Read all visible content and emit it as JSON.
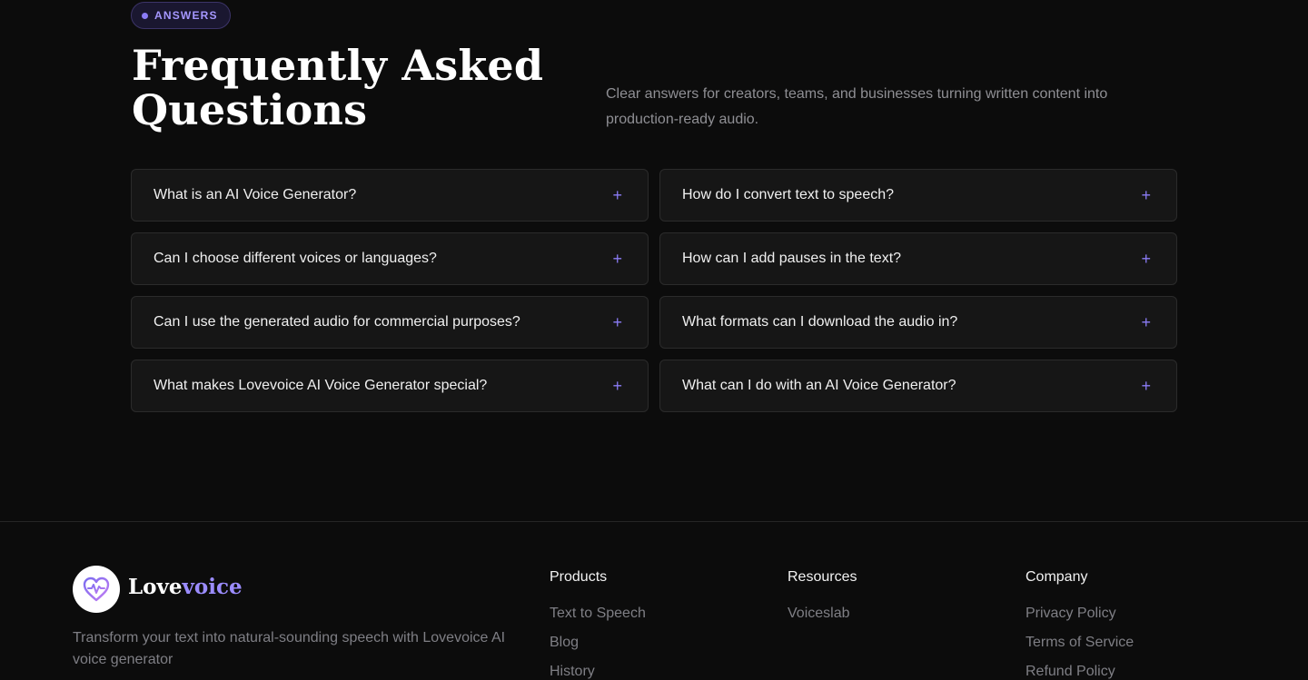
{
  "badge": {
    "label": "ANSWERS"
  },
  "faq": {
    "title_line1": "Frequently Asked",
    "title_line2": "Questions",
    "subtitle": "Clear answers for creators, teams, and businesses turning written content into production-ready audio.",
    "expand_icon": "+",
    "questions": [
      "What is an AI Voice Generator?",
      "How do I convert text to speech?",
      "Can I choose different voices or languages?",
      "How can I add pauses in the text?",
      "Can I use the generated audio for commercial purposes?",
      "What formats can I download the audio in?",
      "What makes Lovevoice AI Voice Generator special?",
      "What can I do with an AI Voice Generator?"
    ]
  },
  "footer": {
    "brand_part1": "Love",
    "brand_part2": "voice",
    "tagline": "Transform your text into natural-sounding speech with Lovevoice AI voice generator",
    "columns": {
      "products": {
        "heading": "Products",
        "links": [
          "Text to Speech",
          "Blog",
          "History"
        ]
      },
      "resources": {
        "heading": "Resources",
        "links": [
          "Voiceslab"
        ]
      },
      "company": {
        "heading": "Company",
        "links": [
          "Privacy Policy",
          "Terms of Service",
          "Refund Policy"
        ]
      }
    }
  },
  "colors": {
    "background": "#0c0c0c",
    "accent": "#8b7cf6",
    "card": "#161616",
    "muted_text": "#7f7f85"
  },
  "icons": {
    "logo": "heart-pulse-icon",
    "expand": "plus-icon"
  }
}
